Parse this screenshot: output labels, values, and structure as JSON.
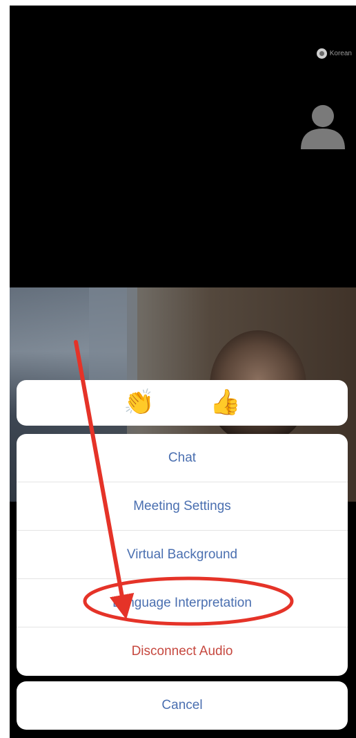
{
  "status": {
    "language_indicator": "Korean",
    "language_icon": "globe-icon"
  },
  "participant": {
    "avatar_icon": "person-avatar-icon"
  },
  "reactions": {
    "clap": "👏",
    "thumbs_up": "👍"
  },
  "menu": {
    "items": [
      {
        "label": "Chat"
      },
      {
        "label": "Meeting Settings"
      },
      {
        "label": "Virtual Background"
      },
      {
        "label": "Language Interpretation"
      },
      {
        "label": "Disconnect Audio"
      }
    ],
    "cancel_label": "Cancel"
  },
  "colors": {
    "menu_text": "#4a6fb0",
    "danger_text": "#c6483f",
    "annotation": "#e53328"
  }
}
